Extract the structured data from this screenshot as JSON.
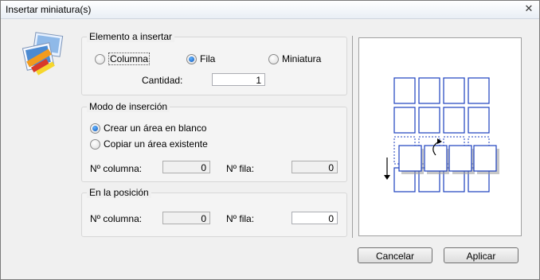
{
  "window": {
    "title": "Insertar miniatura(s)",
    "close_glyph": "✕"
  },
  "element_group": {
    "title": "Elemento a insertar",
    "options": [
      "Columna",
      "Fila",
      "Miniatura"
    ],
    "selected": "Fila",
    "quantity_label": "Cantidad:",
    "quantity_value": "1"
  },
  "mode_group": {
    "title": "Modo de inserción",
    "options": [
      "Crear un área en blanco",
      "Copiar un área existente"
    ],
    "selected": "Crear un área en blanco",
    "column_label": "Nº columna:",
    "column_value": "0",
    "row_label": "Nº fila:",
    "row_value": "0"
  },
  "position_group": {
    "title": "En la posición",
    "column_label": "Nº columna:",
    "column_value": "0",
    "row_label": "Nº fila:",
    "row_value": "0"
  },
  "buttons": {
    "cancel": "Cancelar",
    "apply": "Aplicar"
  },
  "colors": {
    "accent": "#1c3fbf",
    "radio_selected": "#1457b8"
  },
  "icons": [
    "thumbnail-app-icon",
    "close-icon",
    "curved-arrow-icon",
    "down-arrow-icon"
  ]
}
